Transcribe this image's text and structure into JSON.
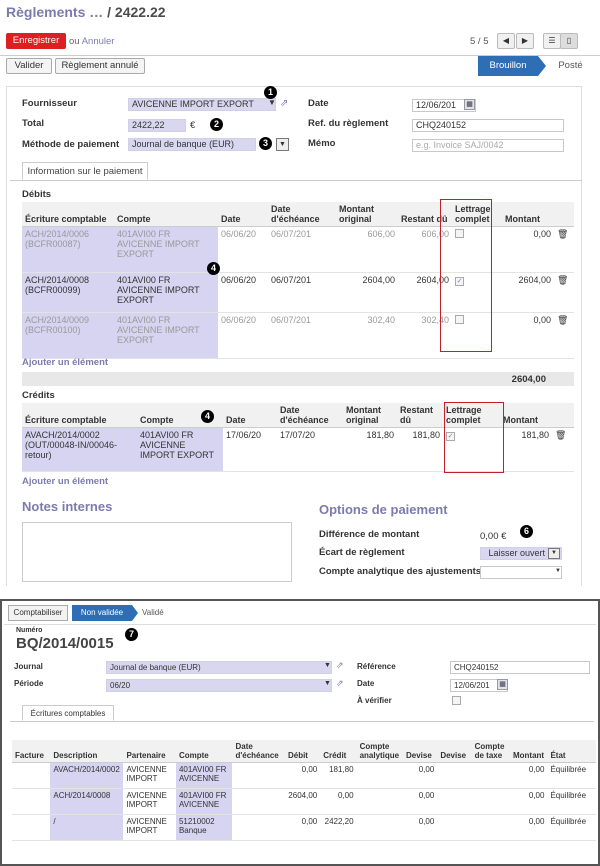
{
  "breadcrumb": {
    "parent": "Règlements …",
    "sep": " / ",
    "current": "2422.22"
  },
  "toolbar": {
    "save": "Enregistrer",
    "or": "ou",
    "discard": "Annuler",
    "pager": "5 / 5"
  },
  "actions": {
    "validate": "Valider",
    "cancel": "Règlement annulé"
  },
  "status": {
    "draft": "Brouillon",
    "posted": "Posté"
  },
  "form": {
    "supplier_label": "Fournisseur",
    "supplier": "AVICENNE IMPORT EXPORT",
    "total_label": "Total",
    "total": "2422,22",
    "currency": "€",
    "method_label": "Méthode de paiement",
    "method": "Journal de banque (EUR)",
    "date_label": "Date",
    "date": "12/06/201",
    "ref_label": "Ref. du règlement",
    "ref": "CHQ240152",
    "memo_label": "Mémo",
    "memo_ph": "e.g. Invoice SAJ/0042"
  },
  "badges": {
    "b1": "1",
    "b2": "2",
    "b3": "3",
    "b4": "4",
    "b6": "6",
    "b7": "7"
  },
  "tab": "Information sur le paiement",
  "debits": {
    "title": "Débits",
    "headers": [
      "Écriture comptable",
      "Compte",
      "Date",
      "Date d'échéance",
      "Montant original",
      "Restant dû",
      "Lettrage complet",
      "Montant"
    ],
    "rows": [
      {
        "entry": "ACH/2014/0006 (BCFR00087)",
        "account": "401AVI00 FR AVICENNE IMPORT EXPORT",
        "date": "06/06/20",
        "due": "06/07/201",
        "orig": "606,00",
        "rest": "606,00",
        "check": "",
        "amount": "0,00",
        "grey": true
      },
      {
        "entry": "ACH/2014/0008 (BCFR00099)",
        "account": "401AVI00 FR AVICENNE IMPORT EXPORT",
        "date": "06/06/20",
        "due": "06/07/201",
        "orig": "2604,00",
        "rest": "2604,00",
        "check": "✓",
        "amount": "2604,00",
        "grey": false
      },
      {
        "entry": "ACH/2014/0009 (BCFR00100)",
        "account": "401AVI00 FR AVICENNE IMPORT EXPORT",
        "date": "06/06/20",
        "due": "06/07/201",
        "orig": "302,40",
        "rest": "302,40",
        "check": "",
        "amount": "0,00",
        "grey": true
      }
    ],
    "add": "Ajouter un élément",
    "total": "2604,00"
  },
  "credits": {
    "title": "Crédits",
    "headers": [
      "Écriture comptable",
      "Compte",
      "Date",
      "Date d'échéance",
      "Montant original",
      "Restant dû",
      "Lettrage complet",
      "Montant"
    ],
    "rows": [
      {
        "entry": "AVACH/2014/0002 (OUT/00048-IN/00046-retour)",
        "account": "401AVI00 FR AVICENNE IMPORT EXPORT",
        "date": "17/06/20",
        "due": "17/07/20",
        "orig": "181,80",
        "rest": "181,80",
        "check": "✓",
        "amount": "181,80"
      }
    ],
    "add": "Ajouter un élément"
  },
  "notes": {
    "title": "Notes internes"
  },
  "options": {
    "title": "Options de paiement",
    "diff_label": "Différence de montant",
    "diff": "0,00 €",
    "writeoff_label": "Écart de règlement",
    "writeoff": "Laisser ouvert",
    "analytic_label": "Compte analytique des ajustements"
  },
  "move": {
    "status": [
      "Comptabiliser",
      "Non validée",
      "Validé"
    ],
    "number_label": "Numéro",
    "number": "BQ/2014/0015",
    "journal_label": "Journal",
    "journal": "Journal de banque (EUR)",
    "period_label": "Période",
    "period": "06/20",
    "ref_label": "Référence",
    "ref": "CHQ240152",
    "date_label": "Date",
    "date": "12/06/201",
    "check_label": "À vérifier",
    "tab": "Écritures comptables",
    "headers": [
      "Facture",
      "Description",
      "Partenaire",
      "Compte",
      "Date d'échéance",
      "Débit",
      "Crédit",
      "Compte analytique",
      "Devise",
      "Devise",
      "Compte de taxe",
      "Montant",
      "État"
    ],
    "rows": [
      {
        "desc": "AVACH/2014/0002",
        "partner": "AVICENNE IMPORT",
        "account": "401AVI00 FR AVICENNE",
        "debit": "0,00",
        "credit": "181,80",
        "dev": "0,00",
        "amount": "0,00",
        "state": "Équilibrée"
      },
      {
        "desc": "ACH/2014/0008",
        "partner": "AVICENNE IMPORT",
        "account": "401AVI00 FR AVICENNE",
        "debit": "2604,00",
        "credit": "0,00",
        "dev": "0,00",
        "amount": "0,00",
        "state": "Équilibrée"
      },
      {
        "desc": "/",
        "partner": "AVICENNE IMPORT",
        "account": "51210002 Banque",
        "debit": "0,00",
        "credit": "2422,20",
        "dev": "0,00",
        "amount": "0,00",
        "state": "Équilibrée"
      }
    ]
  }
}
